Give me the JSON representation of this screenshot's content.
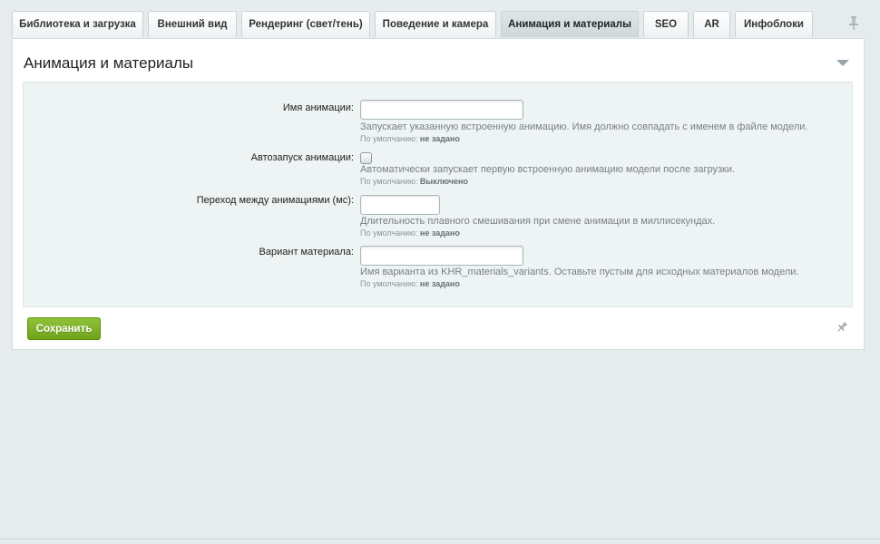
{
  "tabs": [
    {
      "label": "Библиотека и загрузка",
      "active": false
    },
    {
      "label": "Внешний вид",
      "active": false
    },
    {
      "label": "Рендеринг (свет/тень)",
      "active": false
    },
    {
      "label": "Поведение и камера",
      "active": false
    },
    {
      "label": "Анимация и материалы",
      "active": true
    },
    {
      "label": "SEO",
      "active": false
    },
    {
      "label": "AR",
      "active": false
    },
    {
      "label": "Инфоблоки",
      "active": false
    }
  ],
  "panel": {
    "title": "Анимация и материалы"
  },
  "fields": [
    {
      "label": "Имя анимации:",
      "type": "text",
      "value": "",
      "hint": "Запускает указанную встроенную анимацию. Имя должно совпадать с именем в файле модели.",
      "default_prefix": "По умолчанию:",
      "default_value": "не задано"
    },
    {
      "label": "Автозапуск анимации:",
      "type": "checkbox",
      "checked": false,
      "hint": "Автоматически запускает первую встроенную анимацию модели после загрузки.",
      "default_prefix": "По умолчанию:",
      "default_value": "Выключено"
    },
    {
      "label": "Переход между анимациями (мс):",
      "type": "text",
      "value": "",
      "hint": "Длительность плавного смешивания при смене анимации в миллисекундах.",
      "default_prefix": "По умолчанию:",
      "default_value": "не задано"
    },
    {
      "label": "Вариант материала:",
      "type": "text",
      "value": "",
      "hint": "Имя варианта из KHR_materials_variants. Оставьте пустым для исходных материалов модели.",
      "default_prefix": "По умолчанию:",
      "default_value": "не задано"
    }
  ],
  "footer": {
    "save_label": "Сохранить"
  },
  "colors": {
    "accent_green": "#7ab12a",
    "background": "#e6ecee",
    "form_box": "#eef4f4"
  },
  "icons": {
    "pin": "pin-icon",
    "collapse": "chevron-down-icon"
  }
}
